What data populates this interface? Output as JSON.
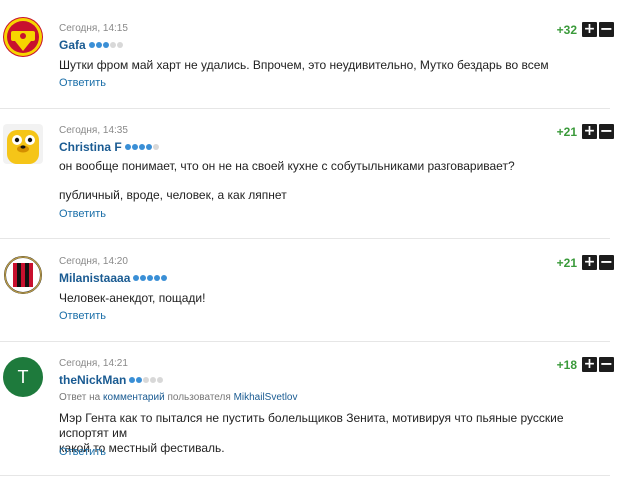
{
  "comments": [
    {
      "time": "Сегодня, 14:15",
      "author": "Gafa",
      "rank": [
        1,
        1,
        1,
        0,
        0
      ],
      "lines": [
        "Шутки фром май харт не удались. Впрочем, это неудивительно, Мутко бездарь во всем"
      ],
      "reply_label": "Ответить",
      "score": "+32",
      "avatar": "manchester-united-logo"
    },
    {
      "time": "Сегодня, 14:35",
      "author": "Christina F",
      "rank": [
        1,
        1,
        1,
        1,
        0
      ],
      "lines": [
        "он вообще понимает, что он не на своей кухне с собутыльниками разговаривает?",
        "публичный, вроде, человек, а как ляпнет"
      ],
      "reply_label": "Ответить",
      "score": "+21",
      "avatar": "jake-the-dog"
    },
    {
      "time": "Сегодня, 14:20",
      "author": "Milanistaaaa",
      "rank": [
        1,
        1,
        1,
        1,
        1
      ],
      "lines": [
        "Человек-анекдот, пощади!"
      ],
      "reply_label": "Ответить",
      "score": "+21",
      "avatar": "ac-milan-logo"
    },
    {
      "time": "Сегодня, 14:21",
      "author": "theNickMan",
      "rank": [
        1,
        1,
        0,
        0,
        0
      ],
      "reply_note": {
        "prefix": "Ответ на",
        "link": "комментарий",
        "middle": "пользователя",
        "user": "MikhailSvetlov"
      },
      "lines": [
        "Мэр Гента как то пытался не пустить болельщиков Зенита, мотивируя что пьяные русские испортят им",
        "какой то местный фестиваль."
      ],
      "reply_label": "Ответить",
      "score": "+18",
      "avatar_letter": "T",
      "avatar_color": "#1e7a3c"
    }
  ],
  "colors": {
    "author": "#1a5b92",
    "score": "#3a9a3a",
    "link": "#1a6ea8"
  }
}
